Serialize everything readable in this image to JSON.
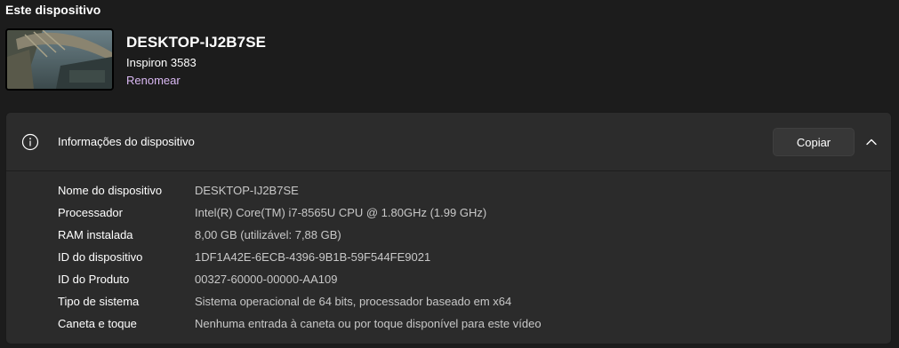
{
  "section_title": "Este dispositivo",
  "device": {
    "name": "DESKTOP-IJ2B7SE",
    "model": "Inspiron 3583",
    "rename_label": "Renomear"
  },
  "card": {
    "icon": "info-icon",
    "title": "Informações do dispositivo",
    "copy_label": "Copiar",
    "chevron_icon": "chevron-up-icon",
    "specs": [
      {
        "label": "Nome do dispositivo",
        "value": "DESKTOP-IJ2B7SE"
      },
      {
        "label": "Processador",
        "value": "Intel(R) Core(TM) i7-8565U CPU @ 1.80GHz (1.99 GHz)"
      },
      {
        "label": "RAM instalada",
        "value": "8,00 GB (utilizável: 7,88 GB)"
      },
      {
        "label": "ID do dispositivo",
        "value": "1DF1A42E-6ECB-4396-9B1B-59F544FE9021"
      },
      {
        "label": "ID do Produto",
        "value": "00327-60000-00000-AA109"
      },
      {
        "label": "Tipo de sistema",
        "value": "Sistema operacional de 64 bits, processador baseado em x64"
      },
      {
        "label": "Caneta e toque",
        "value": "Nenhuma entrada à caneta ou por toque disponível para este vídeo"
      }
    ]
  },
  "colors": {
    "background": "#1c1c1c",
    "card": "#2b2b2b",
    "accent_link": "#d9b8f2"
  }
}
